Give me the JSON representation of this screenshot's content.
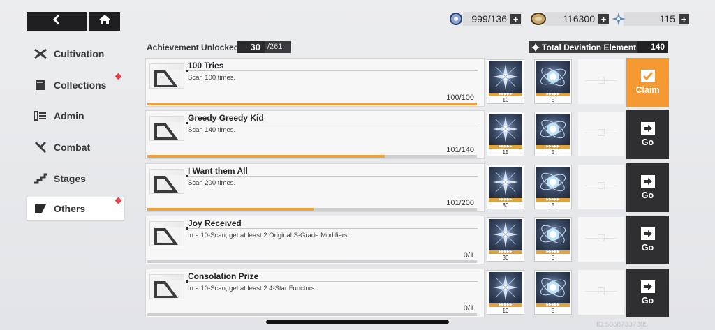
{
  "nav": {
    "back_icon": "back-arrow-icon",
    "home_icon": "home-icon"
  },
  "sidebar": {
    "items": [
      {
        "label": "Cultivation",
        "icon": "crossed-swords-icon",
        "active": false,
        "badge": false
      },
      {
        "label": "Collections",
        "icon": "book-icon",
        "active": false,
        "badge": true
      },
      {
        "label": "Admin",
        "icon": "admin-panel-icon",
        "active": false,
        "badge": false
      },
      {
        "label": "Combat",
        "icon": "combat-blades-icon",
        "active": false,
        "badge": false
      },
      {
        "label": "Stages",
        "icon": "stairs-icon",
        "active": false,
        "badge": false
      },
      {
        "label": "Others",
        "icon": "others-flag-icon",
        "active": true,
        "badge": true
      }
    ]
  },
  "currencies": [
    {
      "icon": "energy-crystal-icon",
      "value": "999/136"
    },
    {
      "icon": "gold-coin-icon",
      "value": "116300"
    },
    {
      "icon": "star-shard-icon",
      "value": "115"
    }
  ],
  "header": {
    "achievement_label": "Achievement Unlocked",
    "achievement_count": "30",
    "achievement_total": "/261",
    "deviation_label": "Total Deviation Element",
    "deviation_value": "140"
  },
  "achievements": [
    {
      "title": "100 Tries",
      "desc": "Scan 100 times.",
      "progress_text": "100/100",
      "progress": 1.0,
      "rewards": [
        "10",
        "5"
      ],
      "action": "Claim",
      "action_type": "claim"
    },
    {
      "title": "Greedy Greedy Kid",
      "desc": "Scan 140 times.",
      "progress_text": "101/140",
      "progress": 0.721,
      "rewards": [
        "15",
        "5"
      ],
      "action": "Go",
      "action_type": "go"
    },
    {
      "title": "I Want them All",
      "desc": "Scan 200 times.",
      "progress_text": "101/200",
      "progress": 0.505,
      "rewards": [
        "30",
        "5"
      ],
      "action": "Go",
      "action_type": "go"
    },
    {
      "title": "Joy Received",
      "desc": "In a 10-Scan, get at least 2 Original S-Grade Modifiers.",
      "progress_text": "0/1",
      "progress": 0,
      "rewards": [
        "30",
        "5"
      ],
      "action": "Go",
      "action_type": "go"
    },
    {
      "title": "Consolation Prize",
      "desc": "In a 10-Scan, get at least 2 4-Star Functors.",
      "progress_text": "0/1",
      "progress": 0,
      "rewards": [
        "10",
        "5"
      ],
      "action": "Go",
      "action_type": "go"
    }
  ],
  "footer": {
    "uid": "ID:58687337805"
  }
}
